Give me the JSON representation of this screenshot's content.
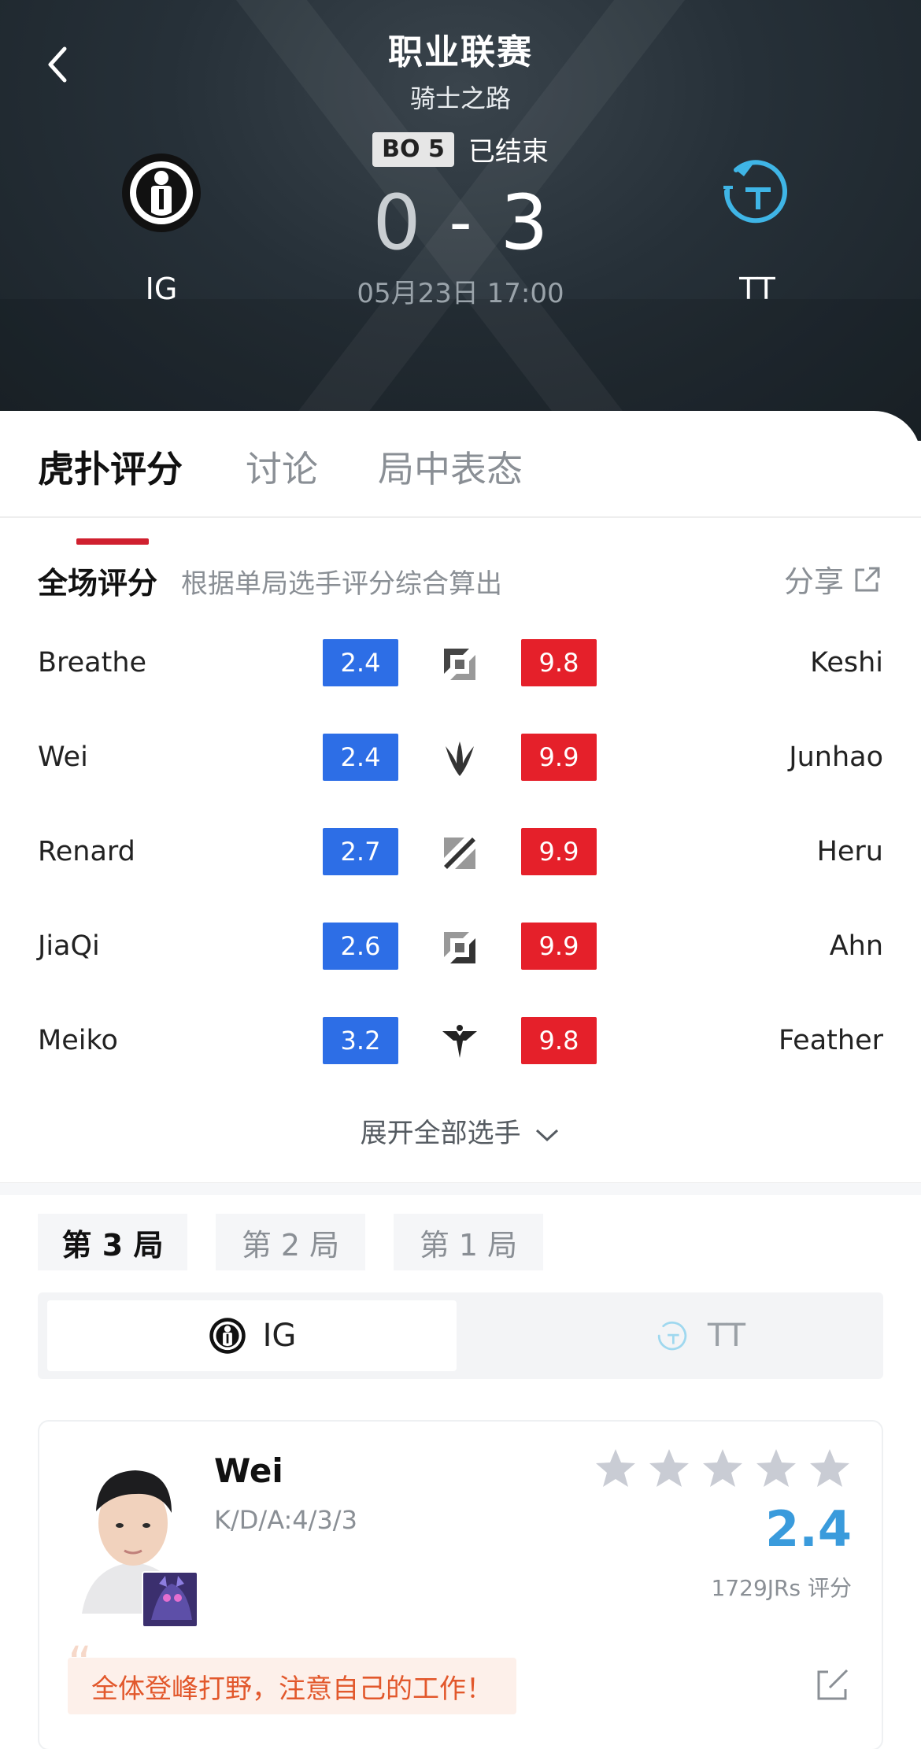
{
  "header": {
    "league_title": "职业联赛",
    "league_subtitle": "骑士之路",
    "bo_label": "BO 5",
    "status": "已结束",
    "score_left": "0",
    "score_sep": "-",
    "score_right": "3",
    "datetime": "05月23日 17:00",
    "team_left": "IG",
    "team_right": "TT"
  },
  "tabs": [
    {
      "label": "虎扑评分",
      "active": true
    },
    {
      "label": "讨论",
      "active": false
    },
    {
      "label": "局中表态",
      "active": false
    }
  ],
  "overall": {
    "title": "全场评分",
    "desc": "根据单局选手评分综合算出",
    "share_label": "分享",
    "rows": [
      {
        "left": "Breathe",
        "left_score": "2.4",
        "role": "top-icon",
        "right_score": "9.8",
        "right": "Keshi"
      },
      {
        "left": "Wei",
        "left_score": "2.4",
        "role": "jungle-icon",
        "right_score": "9.9",
        "right": "Junhao"
      },
      {
        "left": "Renard",
        "left_score": "2.7",
        "role": "mid-icon",
        "right_score": "9.9",
        "right": "Heru"
      },
      {
        "left": "JiaQi",
        "left_score": "2.6",
        "role": "bot-icon",
        "right_score": "9.9",
        "right": "Ahn"
      },
      {
        "left": "Meiko",
        "left_score": "3.2",
        "role": "support-icon",
        "right_score": "9.8",
        "right": "Feather"
      }
    ],
    "expand_label": "展开全部选手"
  },
  "games": [
    {
      "label": "第 3 局",
      "active": true
    },
    {
      "label": "第 2 局",
      "active": false
    },
    {
      "label": "第 1 局",
      "active": false
    }
  ],
  "team_switch": {
    "left": "IG",
    "right": "TT"
  },
  "player_card": {
    "name": "Wei",
    "kda": "K/D/A:4/3/3",
    "rating": "2.4",
    "rating_count": "1729JRs 评分",
    "comment": "全体登峰打野，注意自己的工作！"
  },
  "colors": {
    "accent_red": "#d0202f",
    "score_blue": "#2d6ee6",
    "score_red": "#e5202a",
    "rating_blue": "#3a9bdc",
    "comment_orange": "#e2582c"
  }
}
